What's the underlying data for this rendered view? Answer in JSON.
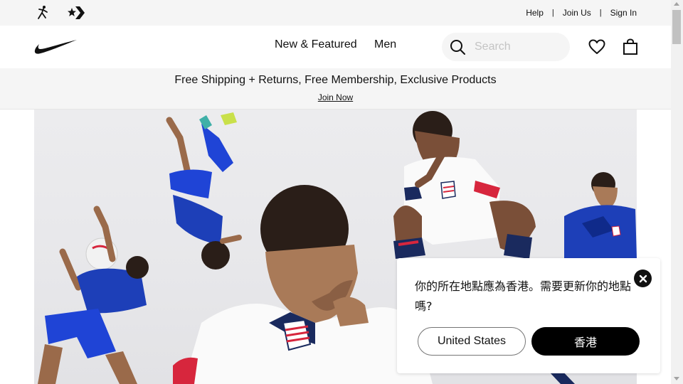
{
  "utility_bar": {
    "brand_icons": [
      "jordan-icon",
      "converse-icon"
    ],
    "links": [
      "Help",
      "Join Us",
      "Sign In"
    ],
    "separator": "|"
  },
  "nav": {
    "logo": "nike-swoosh-icon",
    "items": [
      "New & Featured",
      "Men"
    ],
    "search": {
      "placeholder": "Search",
      "value": ""
    },
    "icons": [
      "search-icon",
      "heart-icon",
      "bag-icon"
    ]
  },
  "promo": {
    "text": "Free Shipping + Returns, Free Membership, Exclusive Products",
    "link": "Join Now"
  },
  "location_modal": {
    "message": "你的所在地點應為香港。需要更新你的地點嗎?",
    "secondary_button": "United States",
    "primary_button": "香港"
  },
  "colors": {
    "brand": "#111111",
    "light_bg": "#f5f5f5",
    "jersey_blue": "#1d3fb8",
    "jersey_red": "#d7263d"
  }
}
